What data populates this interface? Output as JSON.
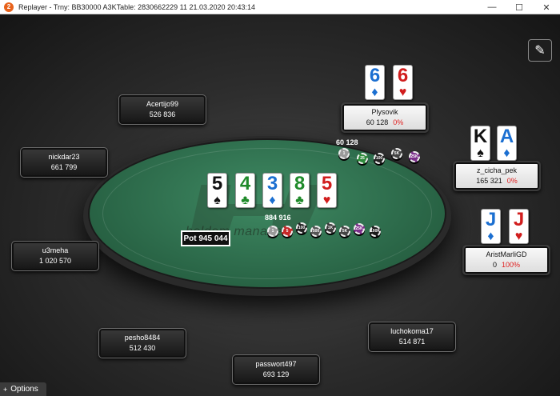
{
  "window": {
    "app_icon": "2",
    "title": "Replayer - Trny: BB30000 A3KTable: 2830662229 11    21.03.2020 20:43:14",
    "minimize": "—",
    "maximize": "☐",
    "close": "✕"
  },
  "players": [
    {
      "name": "Acertijo99",
      "stack": "526 836"
    },
    {
      "name": "nickdar23",
      "stack": "661 799"
    },
    {
      "name": "u3meha",
      "stack": "1 020 570"
    },
    {
      "name": "pesho8484",
      "stack": "512 430"
    },
    {
      "name": "passwort497",
      "stack": "693 129"
    },
    {
      "name": "luchokoma17",
      "stack": "514 871"
    },
    {
      "name": "Plysovik",
      "stack": "60 128",
      "pct": "0%"
    },
    {
      "name": "z_cicha_pek",
      "stack": "165 321",
      "pct": "0%"
    },
    {
      "name": "AristMarliGD",
      "stack": "0",
      "pct": "100%"
    }
  ],
  "hole_cards": {
    "plysovik": [
      {
        "rank": "6",
        "suit": "♦"
      },
      {
        "rank": "6",
        "suit": "♥"
      }
    ],
    "z_cicha_pek": [
      {
        "rank": "K",
        "suit": "♠"
      },
      {
        "rank": "A",
        "suit": "♦"
      }
    ],
    "aristmarligd": [
      {
        "rank": "J",
        "suit": "♦"
      },
      {
        "rank": "J",
        "suit": "♥"
      }
    ]
  },
  "board": [
    {
      "rank": "5",
      "suit": "♠"
    },
    {
      "rank": "4",
      "suit": "♣"
    },
    {
      "rank": "3",
      "suit": "♦"
    },
    {
      "rank": "8",
      "suit": "♣"
    },
    {
      "rank": "5",
      "suit": "♥"
    }
  ],
  "pot": "Pot 945 044",
  "bets": {
    "plysovik": "60 128",
    "center": "884 916"
  },
  "chips_top": [
    "1",
    "25",
    "100",
    "5K",
    "25K"
  ],
  "chips_center": [
    "1",
    "5",
    "100",
    "500",
    "1K",
    "5K",
    "25K",
    "100K"
  ],
  "watermark": "holdem manager",
  "options": {
    "icon": "+",
    "label": "Options"
  },
  "icons": {
    "edit": "pencil-icon"
  },
  "colors": {
    "felt": "#2d6b4b",
    "active_pct": "#e02020"
  }
}
